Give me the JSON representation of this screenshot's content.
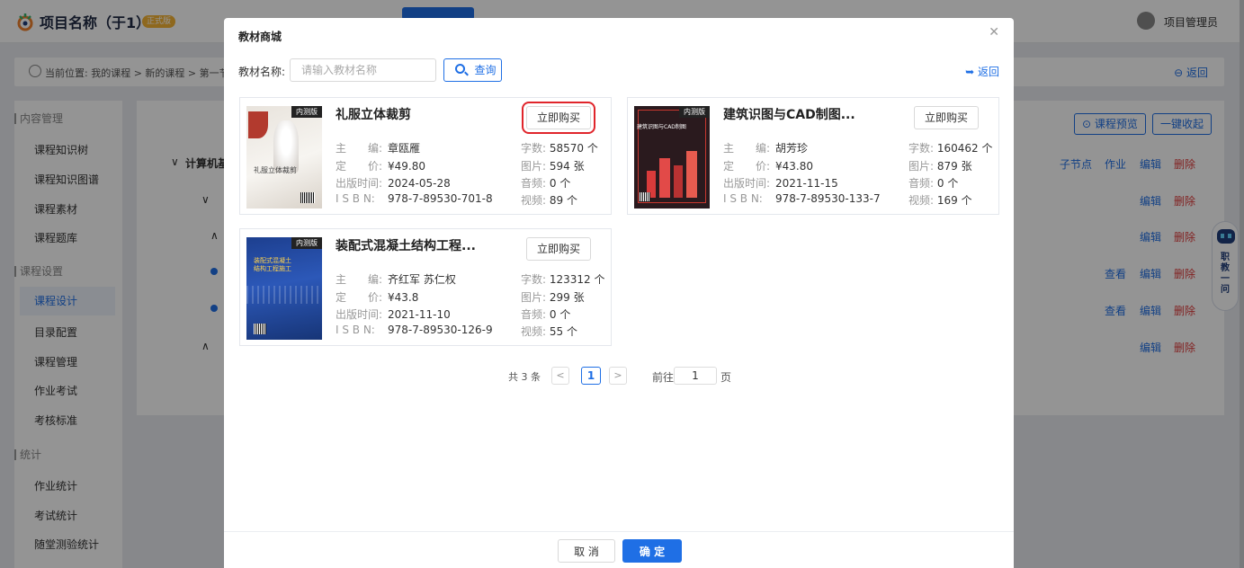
{
  "app": {
    "title": "项目名称（于1）",
    "badge": "正式版",
    "user_name": "项目管理员"
  },
  "breadcrumb": {
    "prefix": "当前位置:",
    "path": "我的课程 > 新的课程 > 第一节",
    "back": "返回"
  },
  "sidebar": {
    "groups": [
      {
        "label": "内容管理",
        "items": [
          "课程知识树",
          "课程知识图谱",
          "课程素材",
          "课程题库"
        ]
      },
      {
        "label": "课程设置",
        "items": [
          "课程设计",
          "目录配置",
          "课程管理",
          "作业考试",
          "考核标准"
        ]
      },
      {
        "label": "统计",
        "items": [
          "作业统计",
          "考试统计",
          "随堂测验统计"
        ]
      }
    ],
    "active": "课程设计"
  },
  "main": {
    "preview_btn": "课程预览",
    "collapse_btn": "一键收起",
    "section_label": "计算机基",
    "row_actions": {
      "sub": "子节点",
      "homework": "作业",
      "view": "查看",
      "edit": "编辑",
      "delete": "删除"
    }
  },
  "assistant": {
    "label": "职教一问"
  },
  "modal": {
    "title": "教材商城",
    "search_label": "教材名称:",
    "search_placeholder": "请输入教材名称",
    "search_button": "查询",
    "back_link": "返回",
    "buy_label": "立即购买",
    "books": [
      {
        "title": "礼服立体裁剪",
        "tag": "内测版",
        "cover_text": "礼服立体裁剪",
        "editor": "章瓯雁",
        "price": "¥49.80",
        "date": "2024-05-28",
        "isbn": "978-7-89530-701-8",
        "words": "58570 个",
        "images": "594 张",
        "audio": "0 个",
        "video": "89 个"
      },
      {
        "title": "建筑识图与CAD制图...",
        "tag": "内测版",
        "cover_text": "建筑识图与CAD制图",
        "editor": "胡芳珍",
        "price": "¥43.80",
        "date": "2021-11-15",
        "isbn": "978-7-89530-133-7",
        "words": "160462 个",
        "images": "879 张",
        "audio": "0 个",
        "video": "169 个"
      },
      {
        "title": "装配式混凝土结构工程...",
        "tag": "内测版",
        "cover_text": "装配式混凝土结构工程施工",
        "editor": "齐红军 苏仁权",
        "price": "¥43.8",
        "date": "2021-11-10",
        "isbn": "978-7-89530-126-9",
        "words": "123312 个",
        "images": "299 张",
        "audio": "0 个",
        "video": "55 个"
      }
    ],
    "labels": {
      "editor": "主　　编:",
      "price": "定　　价:",
      "date": "出版时间:",
      "isbn": "I S B N:",
      "words": "字数:",
      "images": "图片:",
      "audio": "音频:",
      "video": "视频:"
    },
    "pager": {
      "total": "共 3 条",
      "current": "1",
      "goto": "前往",
      "page_input": "1",
      "page_suffix": "页"
    },
    "cancel": "取 消",
    "confirm": "确 定"
  },
  "colors": {
    "primary": "#1f6fe5",
    "danger": "#e03b3b",
    "highlight": "#e0252b"
  }
}
